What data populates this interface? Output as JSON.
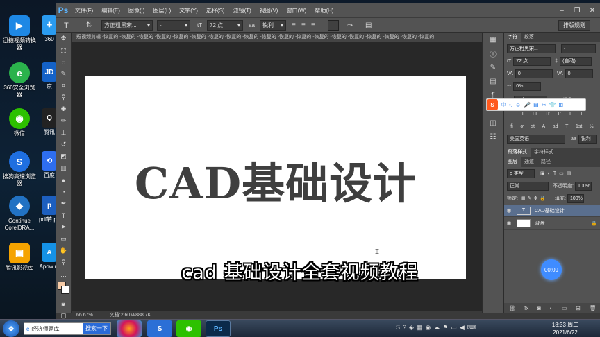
{
  "desktop": {
    "icons": [
      {
        "label": "迅捷视频转换器",
        "glyph": "▶",
        "color": "#1e88e5"
      },
      {
        "label": "360安全浏览器",
        "glyph": "e",
        "color": "#2bb24c"
      },
      {
        "label": "微信",
        "glyph": "◉",
        "color": "#2dc100"
      },
      {
        "label": "搜狗高速浏览器",
        "glyph": "S",
        "color": "#1f6fe0"
      },
      {
        "label": "Continue CorelDRA...",
        "glyph": "◆",
        "color": "#2272c3"
      },
      {
        "label": "腾讯影视库",
        "glyph": "▣",
        "color": "#f5a300"
      }
    ],
    "col2": [
      {
        "label": "360",
        "glyph": "✚",
        "color": "#2a9bf0"
      },
      {
        "label": "京",
        "glyph": "JD",
        "color": "#1462c8"
      },
      {
        "label": "腾讯",
        "glyph": "Q",
        "color": "#222"
      },
      {
        "label": "百度",
        "glyph": "⟲",
        "color": "#2e6ef0"
      },
      {
        "label": "pdf转 ppt转",
        "glyph": "p",
        "color": "#1d5fbf"
      },
      {
        "label": "Apow rc",
        "glyph": "A",
        "color": "#1592e6"
      }
    ]
  },
  "ps": {
    "logo": "Ps",
    "menu": [
      "文件(F)",
      "编辑(E)",
      "图像(I)",
      "图层(L)",
      "文字(Y)",
      "选择(S)",
      "滤镜(T)",
      "视图(V)",
      "窗口(W)",
      "帮助(H)"
    ],
    "options": {
      "font_family": "方正粗黑宋...",
      "font_style": "-",
      "font_size": "72 点",
      "aa_label": "aa",
      "aa_mode": "锐利",
      "workspace_button": "排版规则"
    },
    "doc_tab": "短视频剪辑 -恢复的 -恢复的 -恢复的 -恢复的 -恢复的 -恢复的 -恢复的 -恢复的 -恢复的 -恢复的 -恢复的 -恢复的 -恢复的 -恢复的 -恢复的 -恢复的 -恢复的 -恢复的 -恢复的",
    "canvas_text": "CAD基础设计",
    "status": {
      "zoom": "66.67%",
      "doc": "文档:2.60M/888.7K"
    },
    "character_panel": {
      "tabs": [
        "字符",
        "段落"
      ],
      "font": "方正粗黑宋...",
      "style": "-",
      "size": "72 点",
      "leading": "(自动)",
      "kerning": "0",
      "tracking": "0",
      "scale": "0%",
      "baseline": "0 点",
      "color_label": "颜色:",
      "type_styles": [
        "T",
        "T",
        "TT",
        "Tr",
        "T'",
        "T,",
        "T",
        "T"
      ],
      "ot_styles": [
        "fi",
        "ơ",
        "st",
        "A",
        "ad",
        "T",
        "1st",
        "½"
      ],
      "language": "美国英语",
      "aa": "锐利"
    },
    "para_styles_tabs": [
      "段落样式",
      "字符样式"
    ],
    "layers_panel": {
      "tabs": [
        "图层",
        "通道",
        "路径"
      ],
      "filter": "ρ 类型",
      "blend": "正常",
      "opacity_label": "不透明度:",
      "opacity": "100%",
      "lock_label": "锁定:",
      "fill_label": "填充:",
      "fill": "100%",
      "layers": [
        {
          "name": "CAD基础设计",
          "thumb": "T"
        },
        {
          "name": "背景",
          "thumb": ""
        }
      ]
    }
  },
  "ime": {
    "logo": "S",
    "items": [
      "中",
      "•,",
      "☺",
      "🎤",
      "▤",
      "✂",
      "👕",
      "⊞"
    ]
  },
  "timer": "00:09",
  "subtitle": "cad 基础设计全套视频教程",
  "taskbar": {
    "search_text": "经济师题库",
    "search_button": "搜索一下",
    "clock_time": "18:33 周二",
    "clock_date": "2021/6/22"
  }
}
